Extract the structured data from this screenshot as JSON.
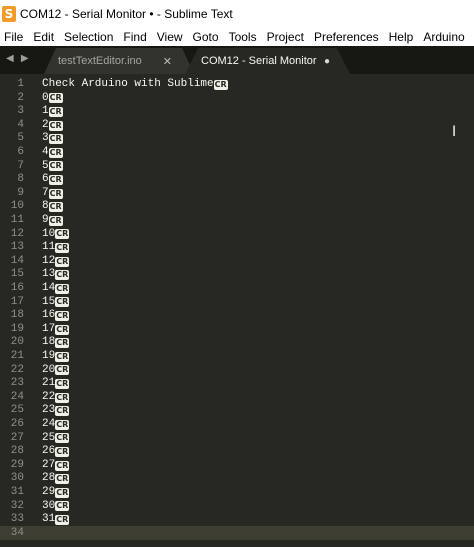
{
  "window": {
    "title": "COM12 - Serial Monitor • - Sublime Text",
    "icon": "sublime-logo-icon"
  },
  "menu": [
    "File",
    "Edit",
    "Selection",
    "Find",
    "View",
    "Goto",
    "Tools",
    "Project",
    "Preferences",
    "Help",
    "Arduino"
  ],
  "tabs": {
    "nav": "◀ ▶",
    "inactive": {
      "label": "testTextEditor.ino",
      "close": "✕"
    },
    "active": {
      "label": "COM12 - Serial Monitor",
      "dirty": "●"
    }
  },
  "editor": {
    "header": "Check Arduino with Sublime",
    "cr_marker": "CR",
    "lines": [
      "0",
      "1",
      "2",
      "3",
      "4",
      "5",
      "6",
      "7",
      "8",
      "9",
      "10",
      "11",
      "12",
      "13",
      "14",
      "15",
      "16",
      "17",
      "18",
      "19",
      "20",
      "21",
      "22",
      "23",
      "24",
      "25",
      "26",
      "27",
      "28",
      "29",
      "30",
      "31"
    ],
    "total_lines": 34,
    "colors": {
      "background": "#272822",
      "text": "#f8f8f2",
      "gutter": "#8f908a"
    }
  }
}
